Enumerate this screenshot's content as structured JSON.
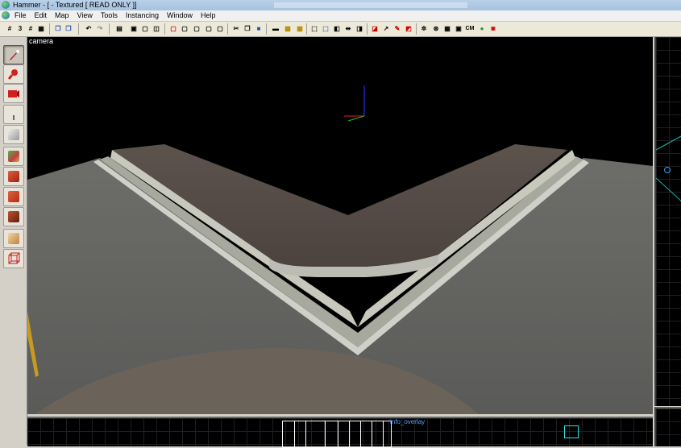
{
  "window": {
    "title": "Hammer - [ - Textured [ READ ONLY ]]"
  },
  "menu": [
    "File",
    "Edit",
    "Map",
    "View",
    "Tools",
    "Instancing",
    "Window",
    "Help"
  ],
  "toolbar": {
    "buttons": [
      "grid-2d-icon",
      "3d-grid-icon",
      "grid-hash-icon",
      "grid-small-icon",
      "copy-icon",
      "paste-icon",
      "paste-special-icon",
      "undo-icon",
      "redo-icon",
      "carve-icon",
      "group-icon",
      "ungroup-icon",
      "toggle-group-icon",
      "hide-icon",
      "show-icon",
      "hide-selected-icon",
      "texture-lock-icon",
      "cut-icon",
      "copy2-icon",
      "paste2-icon",
      "box-icon",
      "cordon-icon",
      "texture-browser-icon",
      "select-icon",
      "clip-icon",
      "vertex-icon",
      "entity-icon",
      "decal-icon",
      "overlay-icon",
      "path-icon",
      "color-icon",
      "load-icon",
      "cm-label",
      "run-icon",
      "face-edit-icon"
    ],
    "cm_label": "CM"
  },
  "viewport": {
    "label": "camera"
  },
  "bottom_view": {
    "entity_label": "info_overlay"
  },
  "colors": {
    "accent": "#3aa0ff",
    "selection": "#2ee6e6"
  }
}
